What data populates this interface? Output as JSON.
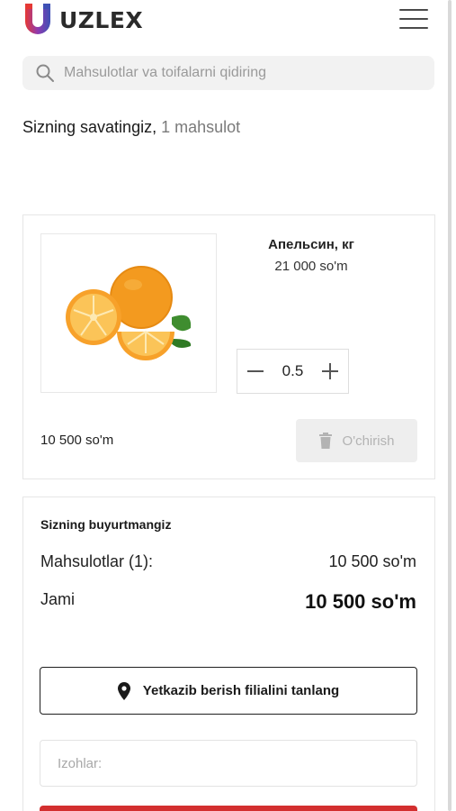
{
  "header": {
    "brand": "UZLEX",
    "logo_icon": "magnet-u-logo",
    "menu_icon": "hamburger-menu-icon"
  },
  "search": {
    "placeholder": "Mahsulotlar va toifalarni qidiring",
    "value": ""
  },
  "cart": {
    "title": "Sizning savatingiz,",
    "count_text": "1 mahsulot",
    "items": [
      {
        "name": "Апельсин, кг",
        "unit_price": "21 000 so'm",
        "quantity": "0.5",
        "line_total": "10 500 so'm",
        "image_icon": "orange-fruit-image",
        "delete_label": "O'chirish"
      }
    ]
  },
  "summary": {
    "title": "Sizning buyurtmangiz",
    "products_label": "Mahsulotlar (1):",
    "products_value": "10 500 so'm",
    "total_label": "Jami",
    "total_value": "10 500 so'm",
    "branch_button": "Yetkazib berish filialini tanlang",
    "notes_placeholder": "Izohlar:"
  },
  "colors": {
    "accent": "#d32f2f",
    "logo_red": "#e53935",
    "logo_blue": "#3f51b5"
  }
}
